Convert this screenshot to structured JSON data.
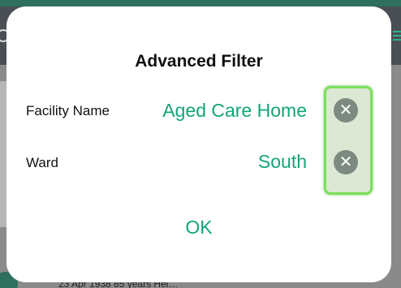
{
  "dialog": {
    "title": "Advanced Filter",
    "rows": [
      {
        "label": "Facility Name",
        "value": "Aged Care Home",
        "clear_icon": "close-icon",
        "clear_glyph": "✕"
      },
      {
        "label": "Ward",
        "value": "South",
        "clear_icon": "close-icon",
        "clear_glyph": "✕"
      }
    ],
    "ok_label": "OK"
  },
  "background": {
    "bottom_text": "23 Apr 1938  85 years  Hel…"
  },
  "colors": {
    "accent": "#12a57a",
    "highlight_border": "#7be05b",
    "clear_button": "#7d8a80",
    "backdrop": "#6f6f6f"
  }
}
